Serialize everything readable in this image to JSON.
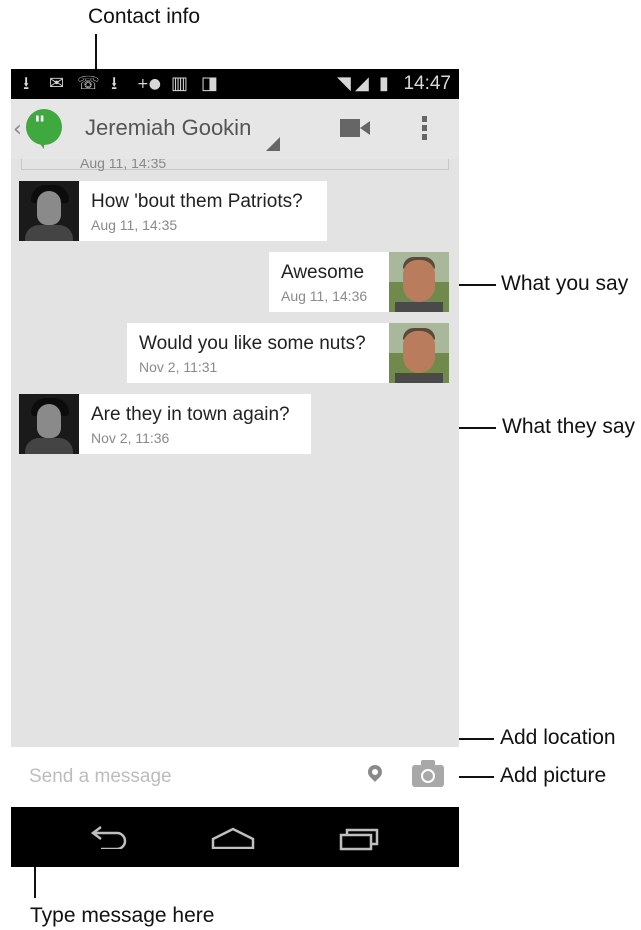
{
  "callouts": {
    "contact_info": "Contact info",
    "what_you_say": "What you say",
    "what_they_say": "What they say",
    "add_location": "Add location",
    "add_picture": "Add picture",
    "type_message_here": "Type message here"
  },
  "status_bar": {
    "time": "14:47",
    "icons": [
      "download-icon",
      "gmail-icon",
      "voicemail-icon",
      "download-icon",
      "add-contact-icon",
      "barcode-icon",
      "play-store-icon",
      "wifi-icon",
      "signal-icon",
      "battery-charging-icon"
    ]
  },
  "action_bar": {
    "contact_name": "Jeremiah Gookin",
    "app_icon": "hangouts-icon"
  },
  "chat": {
    "previous_timestamp": "Aug 11, 14:35",
    "messages": [
      {
        "sender": "them",
        "text": "How 'bout them Patriots?",
        "time": "Aug 11, 14:35"
      },
      {
        "sender": "me",
        "text": "Awesome",
        "time": "Aug 11, 14:36"
      },
      {
        "sender": "me",
        "text": "Would you like some nuts?",
        "time": "Nov 2, 11:31"
      },
      {
        "sender": "them",
        "text": "Are they in town again?",
        "time": "Nov 2, 11:36"
      }
    ]
  },
  "composer": {
    "placeholder": "Send a message",
    "value": ""
  },
  "colors": {
    "hangouts_green": "#3fa83e",
    "chat_background": "#e3e3e3",
    "bubble": "#ffffff"
  }
}
